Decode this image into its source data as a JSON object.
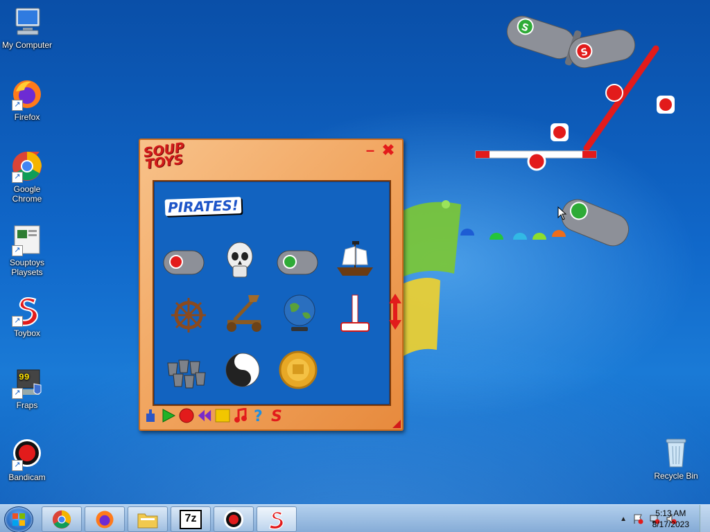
{
  "desktop": {
    "icons": [
      {
        "label": "My Computer"
      },
      {
        "label": "Firefox"
      },
      {
        "label": "Google Chrome"
      },
      {
        "label": "Souptoys Playsets"
      },
      {
        "label": "Toybox"
      },
      {
        "label": "Fraps"
      },
      {
        "label": "Bandicam"
      },
      {
        "label": "Recycle Bin"
      }
    ]
  },
  "soup_window": {
    "logo": "SOUP TOYS",
    "section_title": "PIRATES!",
    "minimize": "–",
    "close": "✖",
    "items": [
      {
        "name": "cannon-red",
        "icon": "cannon-icon"
      },
      {
        "name": "skull",
        "icon": "skull-icon"
      },
      {
        "name": "cannon-green",
        "icon": "cannon-icon"
      },
      {
        "name": "pirate-ship",
        "icon": "ship-icon"
      },
      {
        "name": "ship-wheel",
        "icon": "wheel-icon"
      },
      {
        "name": "catapult",
        "icon": "catapult-icon"
      },
      {
        "name": "globe",
        "icon": "globe-icon"
      },
      {
        "name": "hammer",
        "icon": "hammer-icon"
      },
      {
        "name": "buckets",
        "icon": "buckets-icon"
      },
      {
        "name": "yin-yang",
        "icon": "yin-yang-icon"
      },
      {
        "name": "gold-coin",
        "icon": "coin-icon"
      }
    ],
    "toolbar": [
      "weight-icon",
      "play-icon",
      "record-icon",
      "rewind-icon",
      "stop-icon",
      "music-icon",
      "help-icon",
      "soup-icon"
    ],
    "colors": {
      "frame": "#f0a25b",
      "pane": "#1263c0",
      "accent": "#d21a1a"
    }
  },
  "taskbar": {
    "pinned": [
      "chrome-icon",
      "firefox-icon",
      "explorer-icon",
      "7zip-icon",
      "bandicam-icon",
      "souptoys-icon"
    ],
    "pinned_text": {
      "7zip": "7z"
    },
    "clock": {
      "time": "5:13 AM",
      "date": "8/17/2023"
    },
    "tray_icons": [
      "show-hidden-icon",
      "flag-icon",
      "network-icon",
      "volume-muted-icon"
    ]
  }
}
